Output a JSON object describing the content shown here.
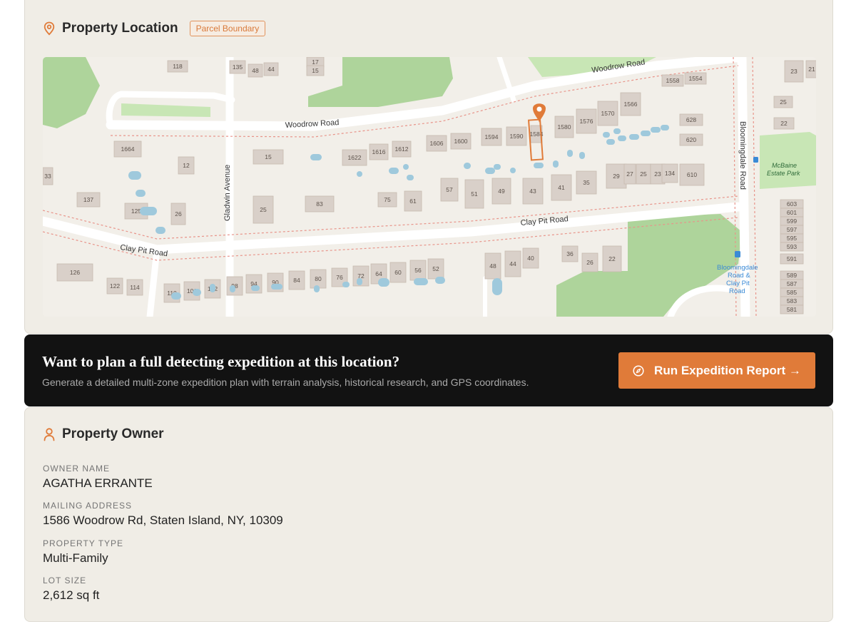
{
  "location_card": {
    "title": "Property Location",
    "badge": "Parcel Boundary",
    "map": {
      "roads": [
        "Woodrow Road",
        "Woodrow Road",
        "Clay Pit Road",
        "Clay Pit Road",
        "Gladwin Avenue",
        "Bloomingdale Road",
        "Bloomingdale Road & Clay Pit Road"
      ],
      "park": "McBaine Estate Park",
      "house_numbers": [
        "118",
        "135",
        "48",
        "44",
        "17",
        "15",
        "1664",
        "12",
        "15",
        "1622",
        "1616",
        "1612",
        "1606",
        "1600",
        "1594",
        "1590",
        "1584",
        "1580",
        "1576",
        "1570",
        "1566",
        "1558",
        "1554",
        "628",
        "620",
        "610",
        "23",
        "25",
        "22",
        "137",
        "125",
        "26",
        "25",
        "83",
        "75",
        "61",
        "57",
        "51",
        "49",
        "43",
        "41",
        "35",
        "29",
        "27",
        "25",
        "23",
        "134",
        "126",
        "122",
        "114",
        "110",
        "106",
        "102",
        "98",
        "94",
        "90",
        "84",
        "80",
        "76",
        "72",
        "64",
        "60",
        "56",
        "52",
        "48",
        "44",
        "40",
        "36",
        "26",
        "22",
        "603",
        "601",
        "599",
        "597",
        "595",
        "593",
        "591",
        "589",
        "587",
        "585",
        "583",
        "581",
        "21",
        "33"
      ]
    }
  },
  "cta": {
    "title": "Want to plan a full detecting expedition at this location?",
    "subtitle": "Generate a detailed multi-zone expedition plan with terrain analysis, historical research, and GPS coordinates.",
    "button": "Run Expedition Report →"
  },
  "owner_card": {
    "title": "Property Owner",
    "fields": [
      {
        "label": "OWNER NAME",
        "value": "AGATHA ERRANTE"
      },
      {
        "label": "MAILING ADDRESS",
        "value": "1586 Woodrow Rd, Staten Island, NY, 10309"
      },
      {
        "label": "PROPERTY TYPE",
        "value": "Multi-Family"
      },
      {
        "label": "LOT SIZE",
        "value": "2,612 sq ft"
      }
    ]
  },
  "colors": {
    "accent": "#e07b39",
    "card_bg": "#f0ede6",
    "cta_bg": "#121212",
    "park": "#aed49b",
    "building": "#d9d0c9",
    "water": "#9fc9dc"
  },
  "icons": {
    "location": "map-pin-icon",
    "owner": "person-icon",
    "button": "compass-icon"
  }
}
